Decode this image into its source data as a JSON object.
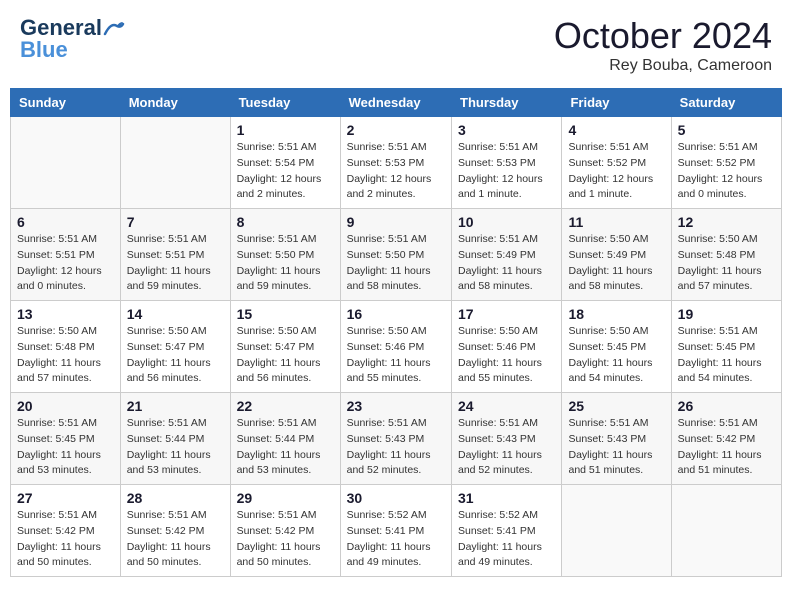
{
  "header": {
    "logo_general": "General",
    "logo_blue": "Blue",
    "month_title": "October 2024",
    "subtitle": "Rey Bouba, Cameroon"
  },
  "weekdays": [
    "Sunday",
    "Monday",
    "Tuesday",
    "Wednesday",
    "Thursday",
    "Friday",
    "Saturday"
  ],
  "weeks": [
    [
      {
        "day": "",
        "info": ""
      },
      {
        "day": "",
        "info": ""
      },
      {
        "day": "1",
        "info": "Sunrise: 5:51 AM\nSunset: 5:54 PM\nDaylight: 12 hours\nand 2 minutes."
      },
      {
        "day": "2",
        "info": "Sunrise: 5:51 AM\nSunset: 5:53 PM\nDaylight: 12 hours\nand 2 minutes."
      },
      {
        "day": "3",
        "info": "Sunrise: 5:51 AM\nSunset: 5:53 PM\nDaylight: 12 hours\nand 1 minute."
      },
      {
        "day": "4",
        "info": "Sunrise: 5:51 AM\nSunset: 5:52 PM\nDaylight: 12 hours\nand 1 minute."
      },
      {
        "day": "5",
        "info": "Sunrise: 5:51 AM\nSunset: 5:52 PM\nDaylight: 12 hours\nand 0 minutes."
      }
    ],
    [
      {
        "day": "6",
        "info": "Sunrise: 5:51 AM\nSunset: 5:51 PM\nDaylight: 12 hours\nand 0 minutes."
      },
      {
        "day": "7",
        "info": "Sunrise: 5:51 AM\nSunset: 5:51 PM\nDaylight: 11 hours\nand 59 minutes."
      },
      {
        "day": "8",
        "info": "Sunrise: 5:51 AM\nSunset: 5:50 PM\nDaylight: 11 hours\nand 59 minutes."
      },
      {
        "day": "9",
        "info": "Sunrise: 5:51 AM\nSunset: 5:50 PM\nDaylight: 11 hours\nand 58 minutes."
      },
      {
        "day": "10",
        "info": "Sunrise: 5:51 AM\nSunset: 5:49 PM\nDaylight: 11 hours\nand 58 minutes."
      },
      {
        "day": "11",
        "info": "Sunrise: 5:50 AM\nSunset: 5:49 PM\nDaylight: 11 hours\nand 58 minutes."
      },
      {
        "day": "12",
        "info": "Sunrise: 5:50 AM\nSunset: 5:48 PM\nDaylight: 11 hours\nand 57 minutes."
      }
    ],
    [
      {
        "day": "13",
        "info": "Sunrise: 5:50 AM\nSunset: 5:48 PM\nDaylight: 11 hours\nand 57 minutes."
      },
      {
        "day": "14",
        "info": "Sunrise: 5:50 AM\nSunset: 5:47 PM\nDaylight: 11 hours\nand 56 minutes."
      },
      {
        "day": "15",
        "info": "Sunrise: 5:50 AM\nSunset: 5:47 PM\nDaylight: 11 hours\nand 56 minutes."
      },
      {
        "day": "16",
        "info": "Sunrise: 5:50 AM\nSunset: 5:46 PM\nDaylight: 11 hours\nand 55 minutes."
      },
      {
        "day": "17",
        "info": "Sunrise: 5:50 AM\nSunset: 5:46 PM\nDaylight: 11 hours\nand 55 minutes."
      },
      {
        "day": "18",
        "info": "Sunrise: 5:50 AM\nSunset: 5:45 PM\nDaylight: 11 hours\nand 54 minutes."
      },
      {
        "day": "19",
        "info": "Sunrise: 5:51 AM\nSunset: 5:45 PM\nDaylight: 11 hours\nand 54 minutes."
      }
    ],
    [
      {
        "day": "20",
        "info": "Sunrise: 5:51 AM\nSunset: 5:45 PM\nDaylight: 11 hours\nand 53 minutes."
      },
      {
        "day": "21",
        "info": "Sunrise: 5:51 AM\nSunset: 5:44 PM\nDaylight: 11 hours\nand 53 minutes."
      },
      {
        "day": "22",
        "info": "Sunrise: 5:51 AM\nSunset: 5:44 PM\nDaylight: 11 hours\nand 53 minutes."
      },
      {
        "day": "23",
        "info": "Sunrise: 5:51 AM\nSunset: 5:43 PM\nDaylight: 11 hours\nand 52 minutes."
      },
      {
        "day": "24",
        "info": "Sunrise: 5:51 AM\nSunset: 5:43 PM\nDaylight: 11 hours\nand 52 minutes."
      },
      {
        "day": "25",
        "info": "Sunrise: 5:51 AM\nSunset: 5:43 PM\nDaylight: 11 hours\nand 51 minutes."
      },
      {
        "day": "26",
        "info": "Sunrise: 5:51 AM\nSunset: 5:42 PM\nDaylight: 11 hours\nand 51 minutes."
      }
    ],
    [
      {
        "day": "27",
        "info": "Sunrise: 5:51 AM\nSunset: 5:42 PM\nDaylight: 11 hours\nand 50 minutes."
      },
      {
        "day": "28",
        "info": "Sunrise: 5:51 AM\nSunset: 5:42 PM\nDaylight: 11 hours\nand 50 minutes."
      },
      {
        "day": "29",
        "info": "Sunrise: 5:51 AM\nSunset: 5:42 PM\nDaylight: 11 hours\nand 50 minutes."
      },
      {
        "day": "30",
        "info": "Sunrise: 5:52 AM\nSunset: 5:41 PM\nDaylight: 11 hours\nand 49 minutes."
      },
      {
        "day": "31",
        "info": "Sunrise: 5:52 AM\nSunset: 5:41 PM\nDaylight: 11 hours\nand 49 minutes."
      },
      {
        "day": "",
        "info": ""
      },
      {
        "day": "",
        "info": ""
      }
    ]
  ]
}
